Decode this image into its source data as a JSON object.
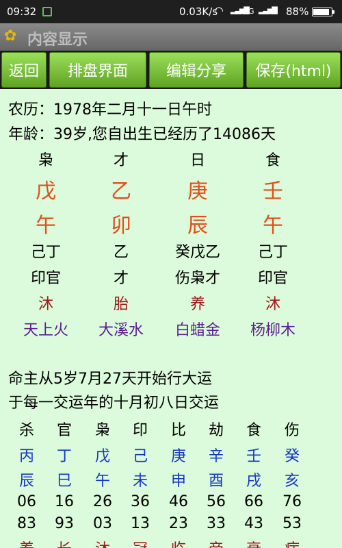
{
  "status_bar": {
    "time": "09:32",
    "network_speed": "0.03K/s",
    "network_type": "4G",
    "network_type2": "G",
    "battery": "88%",
    "battery_level": 0.88
  },
  "title_bar": {
    "title": "内容显示"
  },
  "toolbar": {
    "back_label": "返回",
    "chart_label": "排盘界面",
    "edit_share_label": "编辑分享",
    "save_label": "保存(html)"
  },
  "chart": {
    "lunar_date": "农历：1978年二月十一日午时",
    "age_info": "年龄：39岁,您自出生已经历了14086天",
    "pillars": [
      {
        "ten_god": "枭",
        "stem": "戊",
        "branch": "午",
        "hidden_stems": "己丁",
        "hidden_gods": "印官",
        "life_stage": "沐",
        "nayin": "天上火"
      },
      {
        "ten_god": "才",
        "stem": "乙",
        "branch": "卯",
        "hidden_stems": "乙",
        "hidden_gods": "才",
        "life_stage": "胎",
        "nayin": "大溪水"
      },
      {
        "ten_god": "日",
        "stem": "庚",
        "branch": "辰",
        "hidden_stems": "癸戊乙",
        "hidden_gods": "伤枭才",
        "life_stage": "养",
        "nayin": "白蜡金"
      },
      {
        "ten_god": "食",
        "stem": "壬",
        "branch": "午",
        "hidden_stems": "己丁",
        "hidden_gods": "印官",
        "life_stage": "沐",
        "nayin": "杨柳木"
      }
    ]
  },
  "luck": {
    "start_info": "命主从5岁7月27天开始行大运",
    "transition_info": "于每一交运年的十月初八日交运",
    "periods": [
      {
        "ten_god": "杀",
        "stem": "丙",
        "branch": "辰",
        "start_age": "06",
        "start_year": "83",
        "life_stage": "养"
      },
      {
        "ten_god": "官",
        "stem": "丁",
        "branch": "巳",
        "start_age": "16",
        "start_year": "93",
        "life_stage": "长"
      },
      {
        "ten_god": "枭",
        "stem": "戊",
        "branch": "午",
        "start_age": "26",
        "start_year": "03",
        "life_stage": "沐"
      },
      {
        "ten_god": "印",
        "stem": "己",
        "branch": "未",
        "start_age": "36",
        "start_year": "13",
        "life_stage": "冠"
      },
      {
        "ten_god": "比",
        "stem": "庚",
        "branch": "申",
        "start_age": "46",
        "start_year": "23",
        "life_stage": "临"
      },
      {
        "ten_god": "劫",
        "stem": "辛",
        "branch": "酉",
        "start_age": "56",
        "start_year": "33",
        "life_stage": "帝"
      },
      {
        "ten_god": "食",
        "stem": "壬",
        "branch": "戌",
        "start_age": "66",
        "start_year": "43",
        "life_stage": "衰"
      },
      {
        "ten_god": "伤",
        "stem": "癸",
        "branch": "亥",
        "start_age": "76",
        "start_year": "53",
        "life_stage": "病"
      }
    ]
  },
  "colors": {
    "background": "#dcfadc",
    "stem_branch_orange": "#e0501a",
    "life_stage_red": "#a01818",
    "nayin_purple": "#5a2090",
    "luck_blue": "#1438c8",
    "button_green": "#7cc63c"
  },
  "icons": {
    "title_logo": "sunflower-icon",
    "wifi": "wifi-icon",
    "signal": "signal-icon",
    "battery": "battery-icon"
  }
}
